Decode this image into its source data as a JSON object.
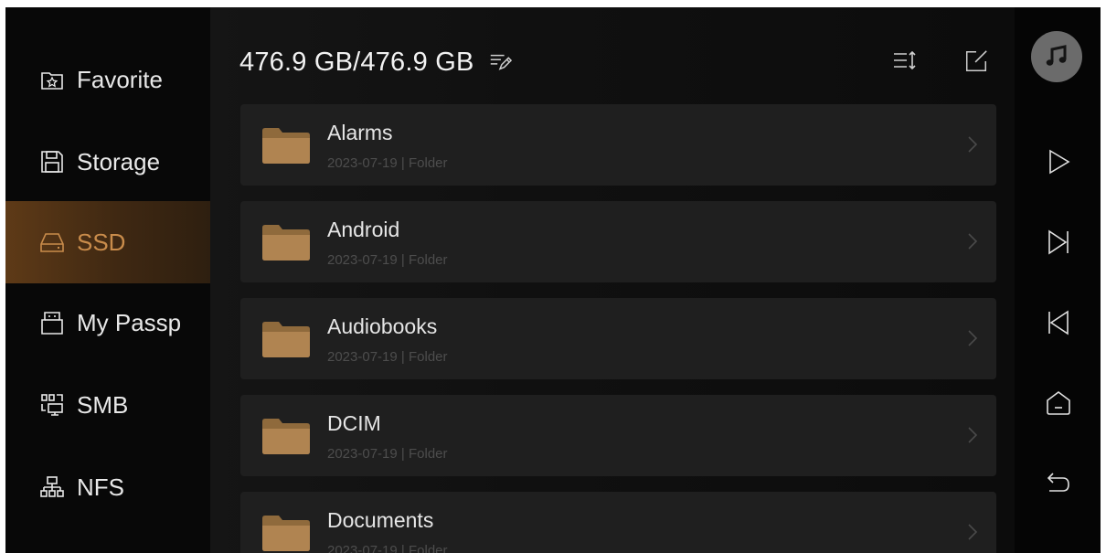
{
  "sidebar": {
    "items": [
      {
        "label": "Favorite",
        "icon": "star-folder-icon"
      },
      {
        "label": "Storage",
        "icon": "floppy-disk-icon"
      },
      {
        "label": "SSD",
        "icon": "hard-drive-icon",
        "active": true
      },
      {
        "label": "My Passp",
        "icon": "usb-drive-icon"
      },
      {
        "label": "SMB",
        "icon": "network-computer-icon"
      },
      {
        "label": "NFS",
        "icon": "network-tree-icon"
      }
    ]
  },
  "header": {
    "storage_text": "476.9 GB/476.9 GB"
  },
  "files": [
    {
      "name": "Alarms",
      "date": "2023-07-19",
      "type": "Folder"
    },
    {
      "name": "Android",
      "date": "2023-07-19",
      "type": "Folder"
    },
    {
      "name": "Audiobooks",
      "date": "2023-07-19",
      "type": "Folder"
    },
    {
      "name": "DCIM",
      "date": "2023-07-19",
      "type": "Folder"
    },
    {
      "name": "Documents",
      "date": "2023-07-19",
      "type": "Folder"
    }
  ],
  "meta_separator": "|",
  "colors": {
    "accent": "#c98c4b",
    "active_bg": "#5e3a17",
    "row_bg": "#1f1f1f",
    "folder": "#a27c4b"
  },
  "right_controls": [
    "music-note-icon",
    "play-icon",
    "skip-next-icon",
    "skip-previous-icon",
    "home-icon",
    "back-icon"
  ]
}
